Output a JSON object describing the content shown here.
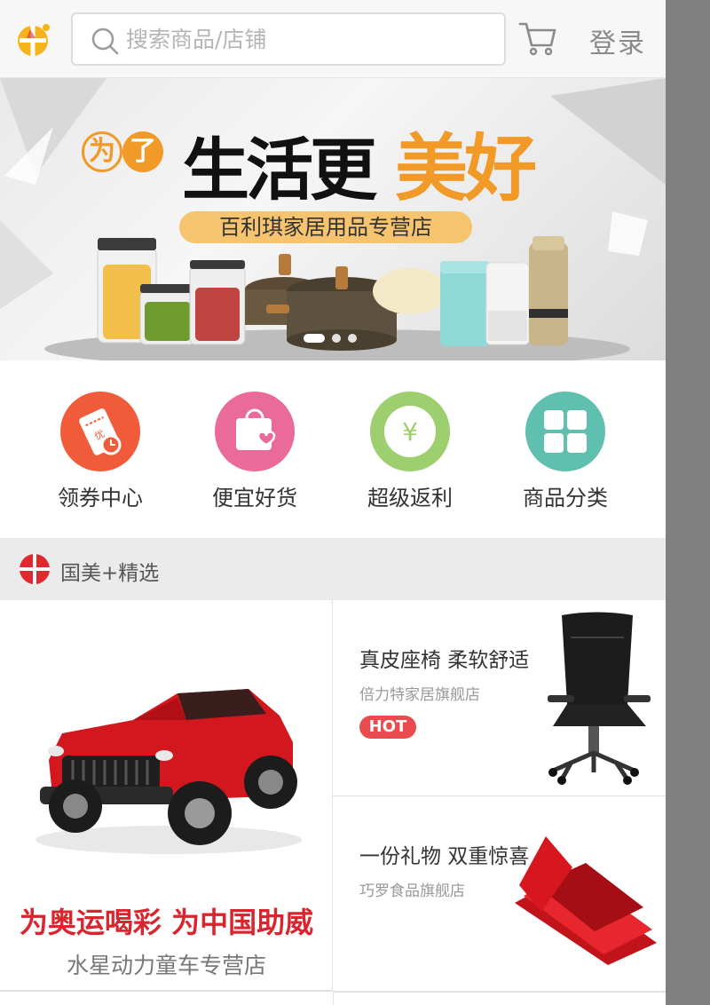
{
  "header": {
    "search_placeholder": "搜索商品/店铺",
    "login_label": "登录"
  },
  "banner": {
    "prefix": "为了",
    "headline_black": "生活更",
    "headline_orange": "美好",
    "store_name": "百利琪家居用品专营店",
    "slide_count": 3,
    "active_slide": 1
  },
  "quick_nav": [
    {
      "label": "领券中心",
      "icon": "coupon-icon",
      "color": "#f05b3a"
    },
    {
      "label": "便宜好货",
      "icon": "shopping-bag-heart-icon",
      "color": "#ea6a9a"
    },
    {
      "label": "超级返利",
      "icon": "yen-rebate-icon",
      "color": "#9dcf6f"
    },
    {
      "label": "商品分类",
      "icon": "category-grid-icon",
      "color": "#5fc0b0"
    }
  ],
  "section": {
    "title": "国美+精选"
  },
  "products": {
    "featured": {
      "slogan": "为奥运喝彩 为中国助威",
      "store": "水星动力童车专营店"
    },
    "items": [
      {
        "title": "真皮座椅 柔软舒适",
        "store": "倍力特家居旗舰店",
        "badge": "HOT"
      },
      {
        "title": "一份礼物 双重惊喜",
        "store": "巧罗食品旗舰店"
      }
    ]
  },
  "colors": {
    "brand_red": "#e0282e",
    "accent_orange": "#f29a28"
  }
}
